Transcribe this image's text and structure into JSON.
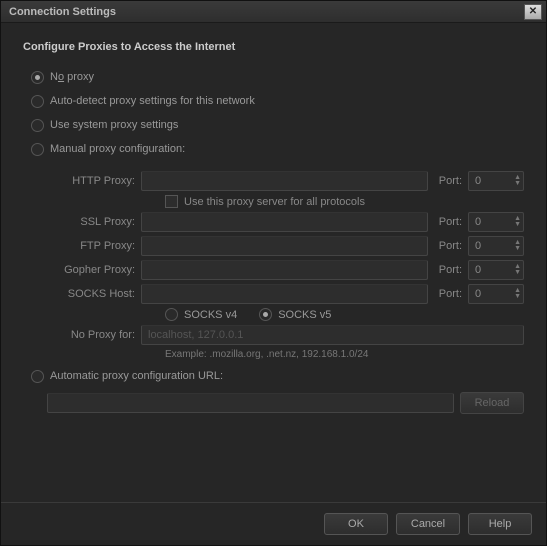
{
  "window": {
    "title": "Connection Settings"
  },
  "section": {
    "title": "Configure Proxies to Access the Internet"
  },
  "radios": {
    "no_proxy": "No proxy",
    "auto_detect": "Auto-detect proxy settings for this network",
    "system": "Use system proxy settings",
    "manual": "Manual proxy configuration:",
    "auto_url": "Automatic proxy configuration URL:",
    "selected": "no_proxy"
  },
  "labels": {
    "http": "HTTP Proxy:",
    "ssl": "SSL Proxy:",
    "ftp": "FTP Proxy:",
    "gopher": "Gopher Proxy:",
    "socks": "SOCKS Host:",
    "port": "Port:",
    "no_proxy_for": "No Proxy for:",
    "use_all": "Use this proxy server for all protocols",
    "socks4": "SOCKS v4",
    "socks5": "SOCKS v5",
    "socks_selected": "v5",
    "example": "Example: .mozilla.org, .net.nz, 192.168.1.0/24",
    "no_proxy_value": "localhost, 127.0.0.1"
  },
  "ports": {
    "http": "0",
    "ssl": "0",
    "ftp": "0",
    "gopher": "0",
    "socks": "0"
  },
  "buttons": {
    "reload": "Reload",
    "ok": "OK",
    "cancel": "Cancel",
    "help": "Help"
  }
}
